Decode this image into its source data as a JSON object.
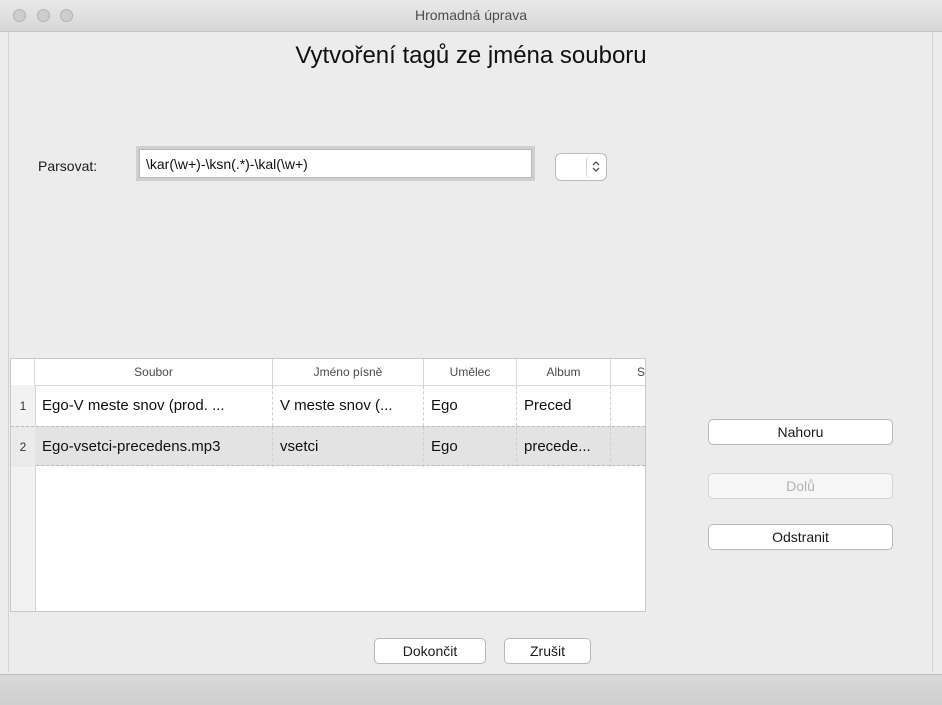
{
  "window": {
    "title": "Hromadná úprava"
  },
  "heading": "Vytvoření tagů ze jména souboru",
  "parse": {
    "label": "Parsovat:",
    "value": "\\kar(\\w+)-\\ksn(.*)-\\kal(\\w+)"
  },
  "table": {
    "columns": [
      "Soubor",
      "Jméno písně",
      "Umělec",
      "Album",
      "S"
    ],
    "rows": [
      {
        "num": "1",
        "cells": [
          "Ego-V meste snov (prod. ...",
          "V meste snov (...",
          "Ego",
          "Preced",
          ""
        ]
      },
      {
        "num": "2",
        "cells": [
          "Ego-vsetci-precedens.mp3",
          "vsetci",
          "Ego",
          "precede...",
          ""
        ]
      }
    ]
  },
  "side_buttons": {
    "up": "Nahoru",
    "down": "Dolů",
    "remove": "Odstranit"
  },
  "bottom_buttons": {
    "finish": "Dokončit",
    "cancel": "Zrušit"
  }
}
